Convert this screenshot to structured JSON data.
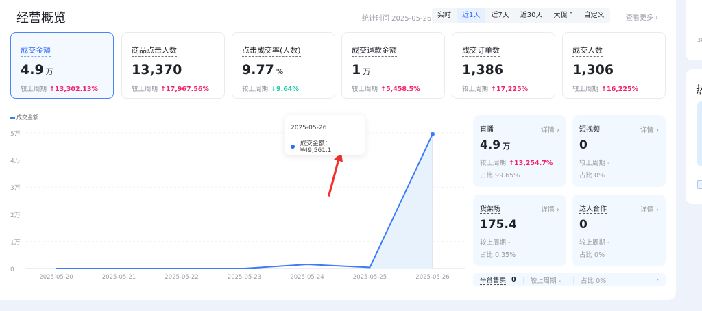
{
  "header": {
    "title": "经营概览",
    "stat_time": "统计时间 2025-05-26",
    "more": "查看更多 ›",
    "tabs": [
      {
        "label": "实时"
      },
      {
        "label": "近1天",
        "active": true
      },
      {
        "label": "近7天"
      },
      {
        "label": "近30天"
      },
      {
        "label": "大促 ˅"
      },
      {
        "label": "自定义"
      }
    ]
  },
  "metrics": [
    {
      "label": "成交金额",
      "value": "4.9",
      "unit": "万",
      "compare_label": "较上周期",
      "change": "↑13,302.13%",
      "dir": "up",
      "selected": true
    },
    {
      "label": "商品点击人数",
      "value": "13,370",
      "unit": "",
      "compare_label": "较上周期",
      "change": "↑17,967.56%",
      "dir": "up"
    },
    {
      "label": "点击成交率(人数)",
      "value": "9.77",
      "unit": "%",
      "compare_label": "较上周期",
      "change": "↓9.64%",
      "dir": "down"
    },
    {
      "label": "成交退款金额",
      "value": "1",
      "unit": "万",
      "compare_label": "较上周期",
      "change": "↑5,458.5%",
      "dir": "up"
    },
    {
      "label": "成交订单数",
      "value": "1,386",
      "unit": "",
      "compare_label": "较上周期",
      "change": "↑17,225%",
      "dir": "up"
    },
    {
      "label": "成交人数",
      "value": "1,306",
      "unit": "",
      "compare_label": "较上周期",
      "change": "↑16,225%",
      "dir": "up"
    }
  ],
  "chart_data": {
    "type": "area",
    "legend": "成交金额",
    "legend_position": "top-left",
    "x": [
      "2025-05-20",
      "2025-05-21",
      "2025-05-22",
      "2025-05-23",
      "2025-05-24",
      "2025-05-25",
      "2025-05-26"
    ],
    "series": [
      {
        "name": "成交金额",
        "values": [
          0,
          0,
          0,
          0,
          1500,
          400,
          49561.1
        ]
      }
    ],
    "y_ticks": [
      "0",
      "1万",
      "2万",
      "3万",
      "4万",
      "5万"
    ],
    "ylim": [
      0,
      50000
    ],
    "grid": true,
    "color": "#3d7bfa",
    "tooltip": {
      "date": "2025-05-26",
      "label": "成交金额：¥49,561.1"
    }
  },
  "channels": [
    {
      "label": "直播",
      "detail": "详情 ›",
      "value": "4.9",
      "unit": "万",
      "compare_label": "较上周期",
      "change": "↑13,254.7%",
      "share": "占比 99.65%"
    },
    {
      "label": "短视频",
      "detail": "详情 ›",
      "value": "0",
      "unit": "",
      "compare_label": "较上周期 -",
      "change": "",
      "share": "占比 0%"
    },
    {
      "label": "货架场",
      "detail": "详情 ›",
      "value": "175.4",
      "unit": "",
      "compare_label": "较上周期 -",
      "change": "",
      "share": "占比 0.35%"
    },
    {
      "label": "达人合作",
      "detail": "详情 ›",
      "value": "0",
      "unit": "",
      "compare_label": "较上周期 -",
      "change": "",
      "share": "占比 0%"
    }
  ],
  "platform": {
    "label": "平台售卖",
    "value": "0",
    "compare": "较上周期 -",
    "share": "占比 0%",
    "arrow": "›"
  },
  "side": {
    "line2": "30",
    "title": "热"
  }
}
